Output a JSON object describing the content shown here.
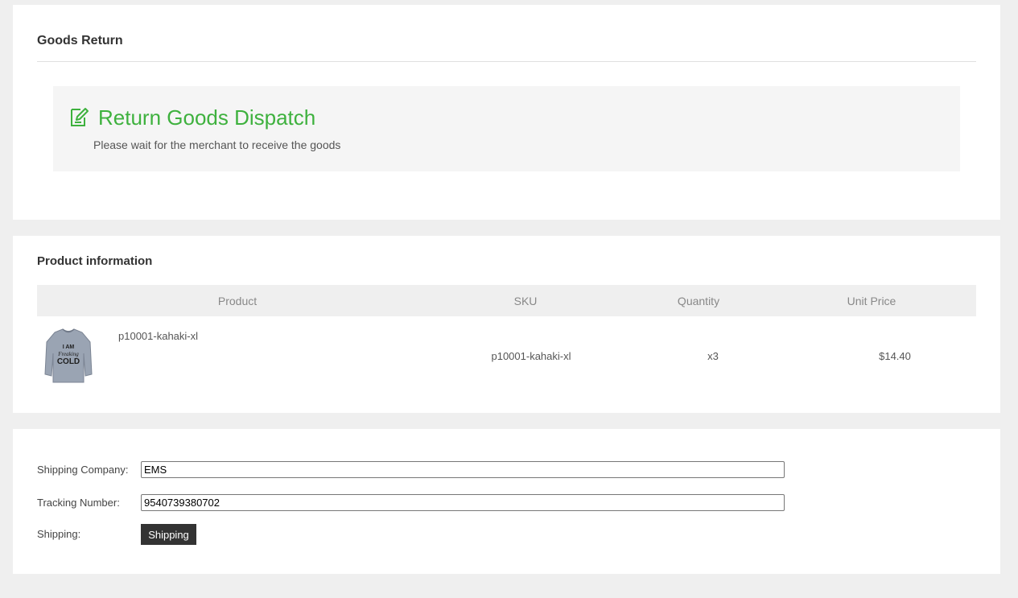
{
  "status_panel": {
    "title": "Goods Return",
    "heading": "Return Goods Dispatch",
    "subtitle": "Please wait for the merchant to receive the goods",
    "icon": "edit-icon",
    "accent_color": "#3eb13e"
  },
  "product_panel": {
    "title": "Product information",
    "columns": [
      "Product",
      "SKU",
      "Quantity",
      "Unit Price"
    ],
    "rows": [
      {
        "name": "p10001-kahaki-xl",
        "sku": "p10001-kahaki-xl",
        "quantity": "x3",
        "unit_price": "$14.40",
        "image": "sweatshirt-thumbnail",
        "image_text": "I AM Freaking COLD"
      }
    ]
  },
  "shipping_panel": {
    "company_label": "Shipping Company:",
    "company_value": "EMS",
    "tracking_label": "Tracking Number:",
    "tracking_value": "9540739380702",
    "shipping_label": "Shipping:",
    "button_label": "Shipping"
  }
}
